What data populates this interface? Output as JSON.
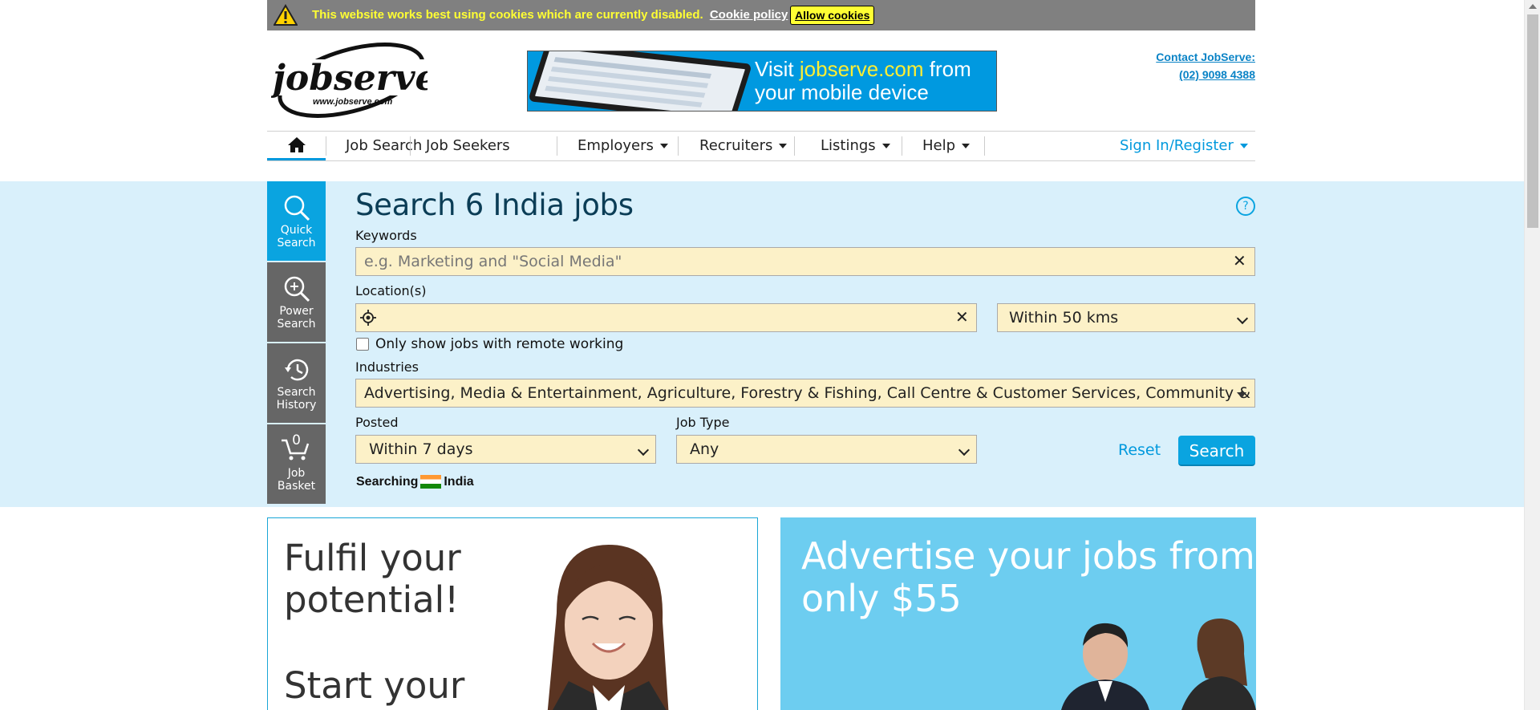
{
  "cookie_bar": {
    "message": "This website works best using cookies which are currently disabled.",
    "policy_link": "Cookie policy",
    "allow_button": "Allow cookies"
  },
  "header": {
    "logo_text": "jobserve",
    "logo_url": "www.jobserve.com",
    "banner_prefix": "Visit ",
    "banner_highlight": "jobserve.com",
    "banner_suffix": " from",
    "banner_line2": "your mobile device",
    "contact_label": "Contact JobServe:",
    "contact_phone": "(02) 9098 4388"
  },
  "nav": {
    "items": [
      {
        "label": "Job Search"
      },
      {
        "label": "Job Seekers"
      },
      {
        "label": "Employers"
      },
      {
        "label": "Recruiters"
      },
      {
        "label": "Listings"
      },
      {
        "label": "Help"
      }
    ],
    "sign_in": "Sign In/Register"
  },
  "side_tabs": [
    {
      "line1": "Quick",
      "line2": "Search"
    },
    {
      "line1": "Power",
      "line2": "Search"
    },
    {
      "line1": "Search",
      "line2": "History"
    },
    {
      "line1": "Job",
      "line2": "Basket",
      "count": "0"
    }
  ],
  "search": {
    "title": "Search 6 India jobs",
    "help": "?",
    "keywords_label": "Keywords",
    "keywords_placeholder": "e.g. Marketing and \"Social Media\"",
    "location_label": "Location(s)",
    "distance_value": "Within 50 kms",
    "remote_label": "Only show jobs with remote working",
    "industries_label": "Industries",
    "industries_value": "Advertising, Media & Entertainment, Agriculture, Forestry & Fishing, Call Centre & Customer Services, Community & Sport, ...",
    "posted_label": "Posted",
    "posted_value": "Within 7 days",
    "jobtype_label": "Job Type",
    "jobtype_value": "Any",
    "reset": "Reset",
    "search_button": "Search",
    "searching_label": "Searching",
    "searching_country": "India"
  },
  "promos": {
    "left_line1": "Fulfil your",
    "left_line2": "potential!",
    "left_line3": "Start your",
    "right_line1": "Advertise your jobs from",
    "right_line2": "only $55"
  }
}
